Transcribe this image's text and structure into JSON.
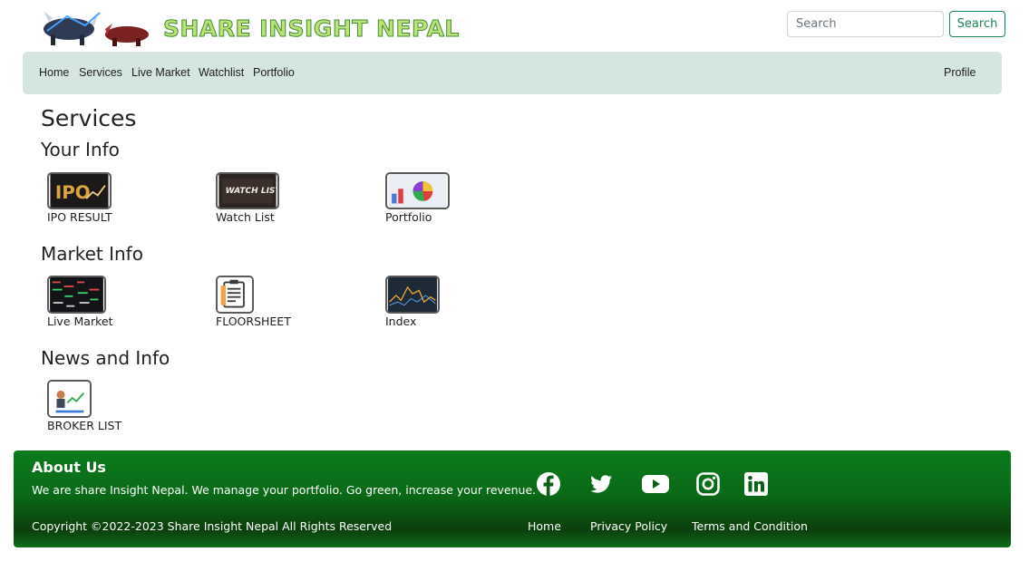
{
  "brand": {
    "name": "Share Insight Nepal"
  },
  "search": {
    "placeholder": "Search",
    "button_label": "Search"
  },
  "nav": {
    "items": [
      "Home",
      "Services",
      "Live Market",
      "Watchlist",
      "Portfolio"
    ],
    "profile_label": "Profile"
  },
  "page": {
    "title": "Services"
  },
  "sections": [
    {
      "title": "Your Info",
      "tiles": [
        "IPO RESULT",
        "Watch List",
        "Portfolio"
      ]
    },
    {
      "title": "Market Info",
      "tiles": [
        "Live Market",
        "FLOORSHEET",
        "Index"
      ]
    },
    {
      "title": "News and Info",
      "tiles": [
        "BROKER LIST"
      ]
    }
  ],
  "tile_images": {
    "ipo": "IPO",
    "watchlist": "WATCH LIST"
  },
  "footer": {
    "about_title": "About Us",
    "about_text": "We are share Insight Nepal. We manage your portfolio. Go green, increase your revenue.",
    "copyright": "Copyright ©2022-2023 Share Insight Nepal All Rights Reserved",
    "links": [
      "Home",
      "Privacy Policy",
      "Terms and Condition"
    ],
    "social_icons": [
      "facebook-icon",
      "twitter-icon",
      "youtube-icon",
      "instagram-icon",
      "linkedin-icon"
    ]
  },
  "colors": {
    "nav_bg": "#d4e6de",
    "accent": "#198754",
    "footer_green": "#0c7a1d"
  }
}
